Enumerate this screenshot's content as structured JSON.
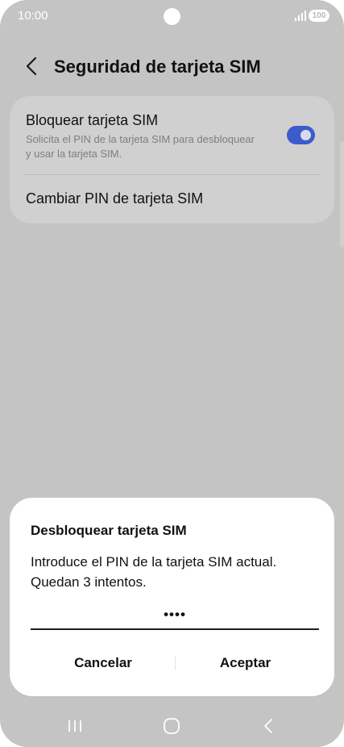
{
  "status_bar": {
    "time": "10:00",
    "battery": "100",
    "icons": [
      "signal-icon",
      "battery-icon"
    ]
  },
  "header": {
    "back_icon": "chevron-left-icon",
    "title": "Seguridad de tarjeta SIM"
  },
  "settings": {
    "lock_sim": {
      "title": "Bloquear tarjeta SIM",
      "description": "Solicita el PIN de la tarjeta SIM para desbloquear y usar la tarjeta SIM.",
      "enabled": true
    },
    "change_pin": {
      "title": "Cambiar PIN de tarjeta SIM"
    }
  },
  "dialog": {
    "title": "Desbloquear tarjeta SIM",
    "message": "Introduce el PIN de la tarjeta SIM actual. Quedan 3 intentos.",
    "pin_value": "••••",
    "cancel_label": "Cancelar",
    "ok_label": "Aceptar"
  },
  "nav_bar": {
    "icons": [
      "recent-apps-icon",
      "home-icon",
      "back-icon"
    ]
  },
  "colors": {
    "background_dim": "#c4c4c4",
    "card": "#d0d0d0",
    "accent": "#3e5bcc",
    "dialog": "#ffffff"
  }
}
